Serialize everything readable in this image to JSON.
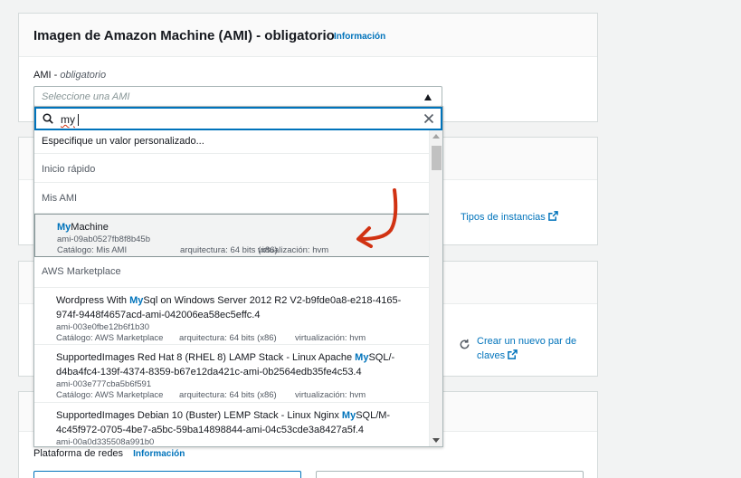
{
  "section_ami": {
    "title": "Imagen de Amazon Machine (AMI) - obligatorio",
    "info_link": "Información",
    "field_label": "AMI",
    "field_required": "obligatorio",
    "select_placeholder": "Seleccione una AMI",
    "search_value": "my",
    "custom_option": "Especifique un valor personalizado...",
    "groups": {
      "quick_start": "Inicio rápido",
      "my_amis": "Mis AMI",
      "marketplace": "AWS Marketplace"
    },
    "my_ami_option": {
      "match": "My",
      "name_rest": "Machine",
      "id": "ami-09ab0527fb8f8b45b",
      "catalog": "Catálogo: Mis AMI",
      "arch": "arquitectura: 64 bits (x86)",
      "virt": "virtualización: hvm"
    },
    "marketplace_options": [
      {
        "name_pre": "Wordpress With ",
        "match": "My",
        "name_post": "Sql on Windows Server 2012 R2 V2-b9fde0a8-e218-4165-974f-9448f4657acd-ami-042006ea58ec5effc.4",
        "id": "ami-003e0fbe12b6f1b30",
        "catalog": "Catálogo: AWS Marketplace",
        "arch": "arquitectura: 64 bits (x86)",
        "virt": "virtualización: hvm"
      },
      {
        "name_pre": "SupportedImages Red Hat 8 (RHEL 8) LAMP Stack - Linux Apache ",
        "match": "My",
        "name_post": "SQL/-d4ba4fc4-139f-4374-8359-b67e12da421c-ami-0b2564edb35fe4c53.4",
        "id": "ami-003e777cba5b6f591",
        "catalog": "Catálogo: AWS Marketplace",
        "arch": "arquitectura: 64 bits (x86)",
        "virt": "virtualización: hvm"
      },
      {
        "name_pre": "SupportedImages Debian 10 (Buster) LEMP Stack - Linux Nginx ",
        "match": "My",
        "name_post": "SQL/M-4c45f972-0705-4be7-a5bc-59ba14898844-ami-04c53cde3a8427a5f.4",
        "id": "ami-00a0d335508a991b0",
        "catalog": "",
        "arch": "",
        "virt": ""
      }
    ]
  },
  "instance_types_link": "Tipos de instancias",
  "create_key_pair_link_line1": "Crear un nuevo par de",
  "create_key_pair_link_line2": "claves",
  "network": {
    "label": "Plataforma de redes",
    "info_link": "Información"
  },
  "colors": {
    "accent": "#0073bb",
    "annotation_arrow": "#d13212"
  },
  "icons": [
    "search-icon",
    "clear-icon",
    "caret-up-icon",
    "external-link-icon",
    "refresh-icon",
    "red-arrow-annotation"
  ]
}
